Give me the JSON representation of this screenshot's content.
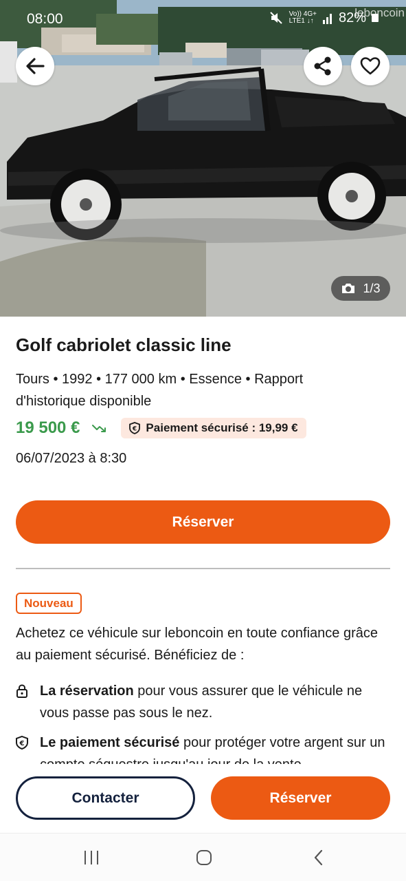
{
  "status_bar": {
    "time": "08:00",
    "network_top": "Vo)) 4G+",
    "network_bottom": "LTE1 ↓↑",
    "battery": "82%",
    "watermark": "leboncoin"
  },
  "photo": {
    "counter": "1/3",
    "icons": {
      "back": "arrow-left-icon",
      "share": "share-icon",
      "favorite": "heart-icon",
      "camera": "camera-icon"
    }
  },
  "listing": {
    "title": "Golf cabriolet classic line",
    "specs": "Tours • 1992 • 177 000 km • Essence • Rapport d'historique disponible",
    "price": "19 500 €",
    "secure_payment": "Paiement sécurisé : 19,99 €",
    "date": "06/07/2023 à 8:30",
    "reserve_label": "Réserver"
  },
  "info": {
    "badge": "Nouveau",
    "intro": "Achetez ce véhicule sur leboncoin en toute confiance grâce au paiement sécurisé. Bénéficiez de :",
    "benefits": [
      {
        "title": "La réservation",
        "text": " pour vous assurer que le véhicule ne vous passe pas sous le nez."
      },
      {
        "title": "Le paiement sécurisé",
        "text": " pour protéger votre argent sur un compte séquestre jusqu'au jour de la vente"
      }
    ]
  },
  "actions": {
    "contact": "Contacter",
    "reserve": "Réserver"
  },
  "colors": {
    "accent": "#ec5a13",
    "price": "#3b9a4c",
    "navy": "#14213d",
    "badge_bg": "#fde8df"
  }
}
